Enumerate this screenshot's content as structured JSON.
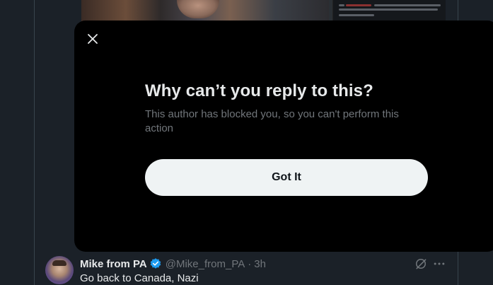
{
  "modal": {
    "title": "Why can’t you reply to this?",
    "description": "This author has blocked you, so you can't perform this action",
    "button_label": "Got It",
    "close_icon": "close-icon"
  },
  "reply": {
    "display_name": "Mike from PA",
    "handle": "@Mike_from_PA",
    "separator": "·",
    "time": "3h",
    "text": "Go back to Canada, Nazi",
    "verified_icon": "verified-badge-icon",
    "verified_color": "#1d9bf0"
  },
  "colors": {
    "background": "#1b2128",
    "modal_background": "#000000",
    "button_background": "#eff3f4",
    "muted_text": "#71767b",
    "primary_text": "#e7e9ea"
  }
}
